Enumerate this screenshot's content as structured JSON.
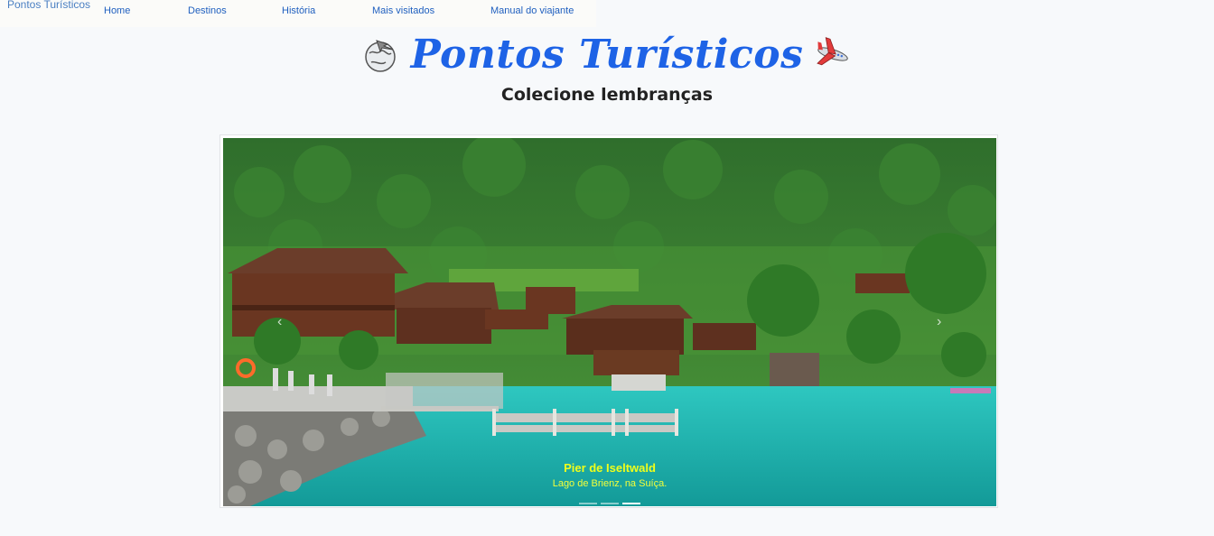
{
  "nav": {
    "brand": "Pontos Turísticos",
    "items": [
      {
        "label": "Home"
      },
      {
        "label": "Destinos"
      },
      {
        "label": "História"
      },
      {
        "label": "Mais visitados"
      },
      {
        "label": "Manual do viajante"
      }
    ]
  },
  "hero": {
    "title": "Pontos Turísticos",
    "subtitle": "Colecione lembranças",
    "left_icon": "globe-plane-icon",
    "right_icon": "airplane-icon"
  },
  "carousel": {
    "caption_title": "Pier de Iseltwald",
    "caption_text": "Lago de Brienz, na Suíça.",
    "slide_count": 3,
    "active_slide": 3,
    "prev_label": "‹",
    "next_label": "›"
  },
  "colors": {
    "title": "#1e63e6",
    "nav_link": "#1f5fbf",
    "caption": "#f0ff1a",
    "lake": "#22b9b4"
  }
}
